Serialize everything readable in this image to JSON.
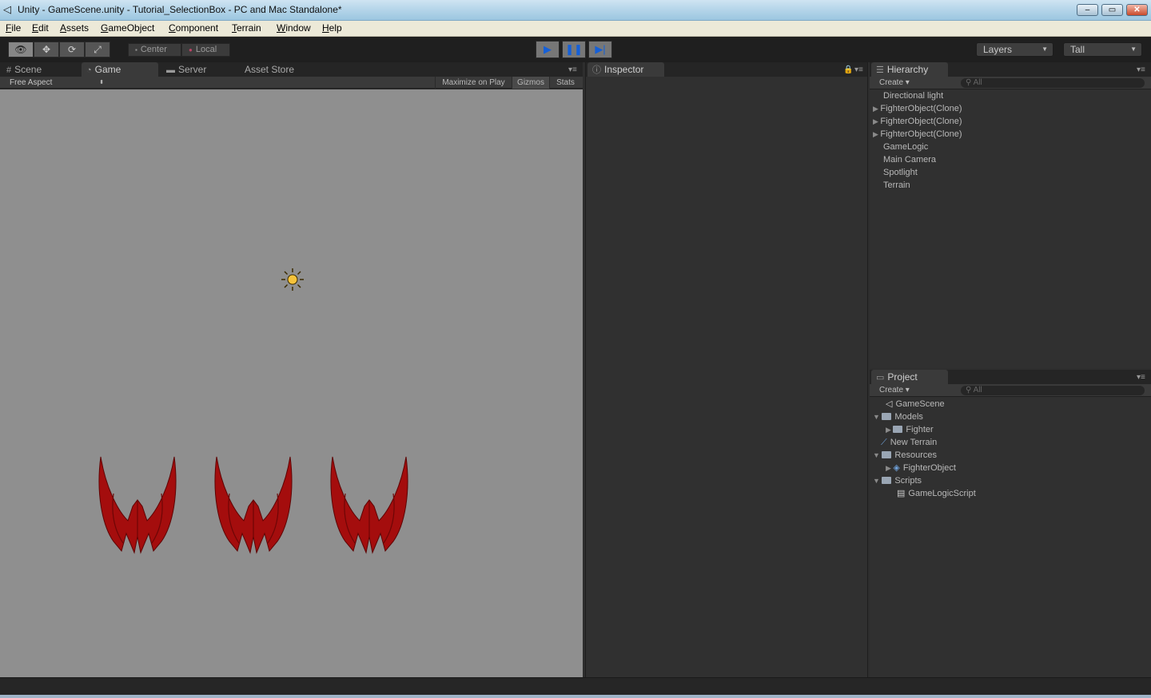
{
  "window": {
    "title": "Unity - GameScene.unity - Tutorial_SelectionBox - PC and Mac Standalone*",
    "buttons": {
      "minimize": "–",
      "maximize": "▭",
      "close": "✕"
    }
  },
  "menu": [
    "File",
    "Edit",
    "Assets",
    "GameObject",
    "Component",
    "Terrain",
    "Window",
    "Help"
  ],
  "toolbar": {
    "tools": [
      "view-tool",
      "move-tool",
      "rotate-tool",
      "scale-tool"
    ],
    "pivot": "Center",
    "space": "Local",
    "layers": "Layers",
    "layout": "Tall"
  },
  "scene_tabs": [
    "Scene",
    "Game",
    "Server",
    "Asset Store"
  ],
  "game": {
    "aspect": "Free Aspect",
    "maximize": "Maximize on Play",
    "gizmos": "Gizmos",
    "stats": "Stats"
  },
  "inspector": {
    "tab": "Inspector"
  },
  "hierarchy": {
    "tab": "Hierarchy",
    "create": "Create",
    "search_placeholder": "All",
    "items": [
      {
        "label": "Directional light",
        "expandable": false
      },
      {
        "label": "FighterObject(Clone)",
        "expandable": true
      },
      {
        "label": "FighterObject(Clone)",
        "expandable": true
      },
      {
        "label": "FighterObject(Clone)",
        "expandable": true
      },
      {
        "label": "GameLogic",
        "expandable": false
      },
      {
        "label": "Main Camera",
        "expandable": false
      },
      {
        "label": "Spotlight",
        "expandable": false
      },
      {
        "label": "Terrain",
        "expandable": false
      }
    ]
  },
  "project": {
    "tab": "Project",
    "create": "Create",
    "search_placeholder": "All",
    "items": [
      {
        "label": "GameScene",
        "icon": "unity-scene-icon"
      },
      {
        "label": "Models",
        "icon": "folder-icon"
      },
      {
        "label": "Fighter",
        "icon": "folder-icon"
      },
      {
        "label": "New Terrain",
        "icon": "terrain-icon"
      },
      {
        "label": "Resources",
        "icon": "folder-icon"
      },
      {
        "label": "FighterObject",
        "icon": "prefab-icon"
      },
      {
        "label": "Scripts",
        "icon": "folder-icon"
      },
      {
        "label": "GameLogicScript",
        "icon": "script-icon"
      }
    ]
  },
  "colors": {
    "game_bg": "#8f8f8f",
    "fighter": "#a40d0d",
    "play_active": "#1560d8"
  }
}
